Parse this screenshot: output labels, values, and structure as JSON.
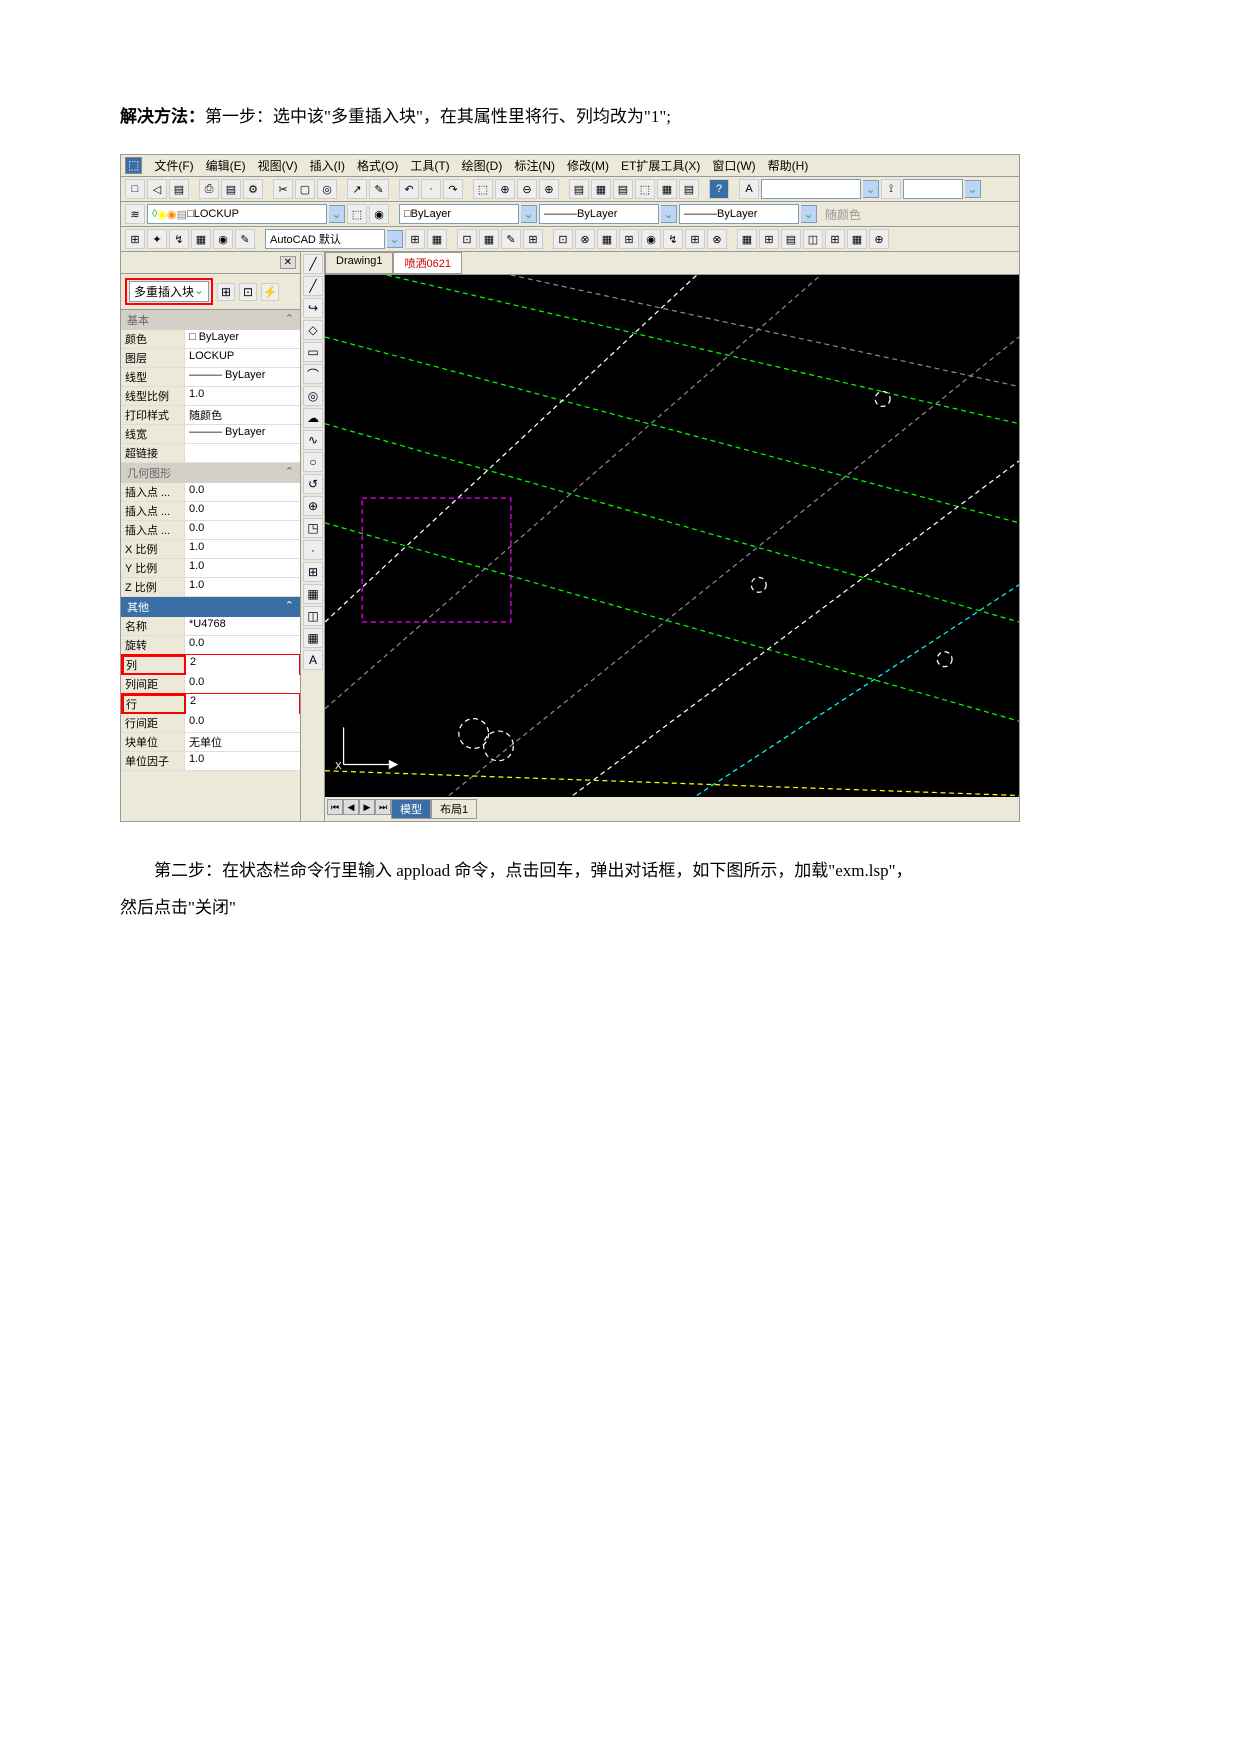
{
  "instruction": {
    "label": "解决方法：",
    "text": "第一步：选中该\"多重插入块\"，在其属性里将行、列均改为\"1\";"
  },
  "menubar": [
    "文件(F)",
    "编辑(E)",
    "视图(V)",
    "插入(I)",
    "格式(O)",
    "工具(T)",
    "绘图(D)",
    "标注(N)",
    "修改(M)",
    "ET扩展工具(X)",
    "窗口(W)",
    "帮助(H)"
  ],
  "toolbar1": {
    "glyphs": [
      "□",
      "◁",
      "▤",
      "",
      "⎙",
      "▤",
      "⚙",
      "",
      "✂",
      "▢",
      "◎",
      "",
      "↗",
      "✎",
      "",
      "↶",
      "·",
      "↷",
      "",
      "⬚",
      "⊕",
      "⊖",
      "⊕",
      "",
      "▤",
      "▦",
      "▤",
      "⬚",
      "▦",
      "▤",
      "",
      "?"
    ]
  },
  "toolbar2": {
    "layer_name": "LOCKUP",
    "bylayer": "ByLayer",
    "bylayer2": "ByLayer",
    "bylayer3": "ByLayer",
    "suffix": "随颜色"
  },
  "toolbar3": {
    "style": "AutoCAD 默认"
  },
  "props": {
    "title": "多重插入块",
    "sections": {
      "basic": {
        "header": "基本",
        "rows": [
          {
            "label": "颜色",
            "value": "□ ByLayer"
          },
          {
            "label": "图层",
            "value": "LOCKUP"
          },
          {
            "label": "线型",
            "value": "——— ByLayer"
          },
          {
            "label": "线型比例",
            "value": "1.0"
          },
          {
            "label": "打印样式",
            "value": "随颜色"
          },
          {
            "label": "线宽",
            "value": "——— ByLayer"
          },
          {
            "label": "超链接",
            "value": ""
          }
        ]
      },
      "geom": {
        "header": "几何图形",
        "rows": [
          {
            "label": "插入点 ...",
            "value": "0.0"
          },
          {
            "label": "插入点 ...",
            "value": "0.0"
          },
          {
            "label": "插入点 ...",
            "value": "0.0"
          },
          {
            "label": "X 比例",
            "value": "1.0"
          },
          {
            "label": "Y 比例",
            "value": "1.0"
          },
          {
            "label": "Z 比例",
            "value": "1.0"
          }
        ]
      },
      "other": {
        "header": "其他",
        "rows": [
          {
            "label": "名称",
            "value": "*U4768"
          },
          {
            "label": "旋转",
            "value": "0.0"
          },
          {
            "label": "列",
            "value": "2",
            "highlight": true
          },
          {
            "label": "列间距",
            "value": "0.0"
          },
          {
            "label": "行",
            "value": "2",
            "highlight": true
          },
          {
            "label": "行间距",
            "value": "0.0"
          },
          {
            "label": "块单位",
            "value": "无单位"
          },
          {
            "label": "单位因子",
            "value": "1.0"
          }
        ]
      }
    }
  },
  "vtool_glyphs": [
    "╱",
    "╱",
    "↪",
    "◇",
    "▭",
    "⌒",
    "◎",
    "☁",
    "∿",
    "○",
    "↺",
    "⊕",
    "◳",
    "·",
    "⊞",
    "▦",
    "◫",
    "▦",
    "A"
  ],
  "tabs": {
    "t1": "Drawing1",
    "t2": "喷洒0621"
  },
  "bottom_tabs": {
    "model": "模型",
    "layout1": "布局1"
  },
  "axis_x": "X",
  "step2": "第二步：在状态栏命令行里输入 appload 命令，点击回车，弹出对话框，如下图所示，加载\"exm.lsp\"，",
  "step2b": "然后点击\"关闭\""
}
